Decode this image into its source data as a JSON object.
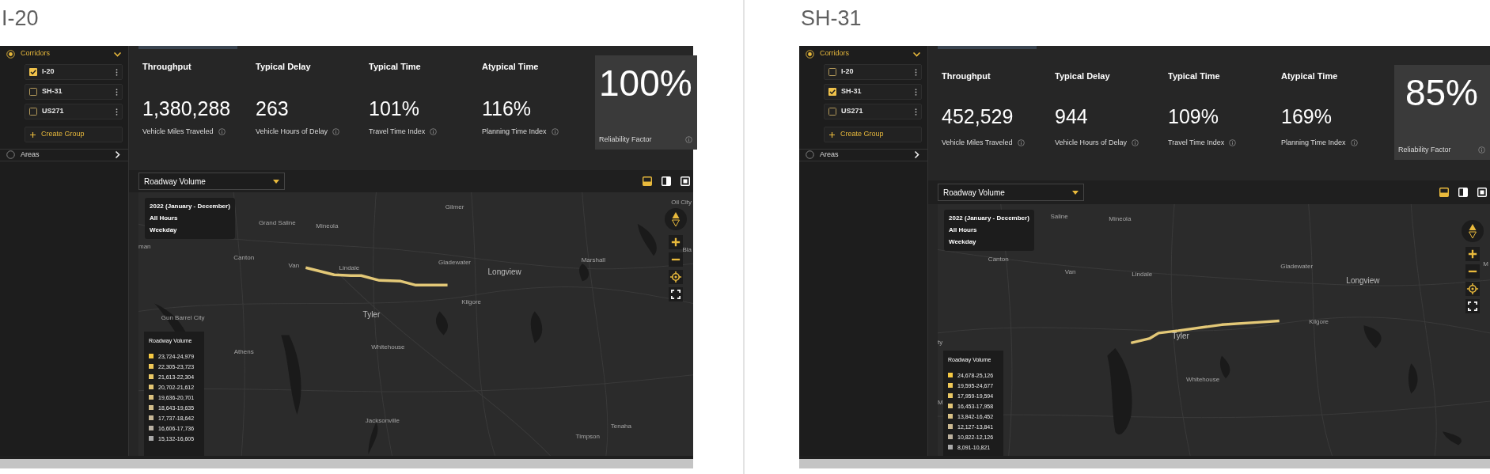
{
  "panels": [
    {
      "heading": "I-20",
      "sidebar": [
        {
          "label": "Corridors",
          "selected": true,
          "expanded": true,
          "items": [
            {
              "label": "I-20",
              "checked": true
            },
            {
              "label": "SH-31",
              "checked": false
            },
            {
              "label": "US271",
              "checked": false
            }
          ],
          "create": "Create Group"
        },
        {
          "label": "Areas",
          "selected": false,
          "expanded": false
        }
      ],
      "metrics": [
        {
          "kind": "plain",
          "title": "Throughput",
          "value": "1,380,288",
          "caption": "Vehicle Miles Traveled"
        },
        {
          "kind": "plain",
          "title": "Typical Delay",
          "value": "263",
          "caption": "Vehicle Hours of Delay"
        },
        {
          "kind": "plain",
          "title": "Typical Time",
          "value": "101%",
          "caption": "Travel Time Index"
        },
        {
          "kind": "plain",
          "title": "Atypical Time",
          "value": "116%",
          "caption": "Planning Time Index"
        },
        {
          "kind": "highlight",
          "value": "100%",
          "caption": "Reliability Factor"
        }
      ],
      "toolbar": {
        "dropdown": "Roadway Volume",
        "views": [
          {
            "kind": "bottom",
            "selected": true
          },
          {
            "kind": "side",
            "selected": false
          },
          {
            "kind": "full",
            "selected": false
          }
        ]
      },
      "map": {
        "info": [
          "2022 (January - December)",
          "All Hours",
          "Weekday"
        ],
        "labels": [
          "Oil City",
          "Gilmer",
          "Grand Saline",
          "Mineola",
          "man",
          "Canton",
          "Van",
          "Lindale",
          "Gladewater",
          "Longview",
          "Marshall",
          "Bla",
          "Kilgore",
          "Tyler",
          "Gun Barrel City",
          "Athens",
          "Whitehouse",
          "Jacksonville",
          "Tenaha",
          "Timpson"
        ],
        "legend": {
          "title": "Roadway Volume",
          "items": [
            {
              "label": "23,724-24,979",
              "color": "#f5c842"
            },
            {
              "label": "22,305-23,723",
              "color": "#f0c857"
            },
            {
              "label": "21,613-22,304",
              "color": "#eac865"
            },
            {
              "label": "20,702-21,612",
              "color": "#e4c673"
            },
            {
              "label": "19,636-20,701",
              "color": "#dcc27f"
            },
            {
              "label": "18,643-19,635",
              "color": "#d2bd8a"
            },
            {
              "label": "17,737-18,642",
              "color": "#c7b796"
            },
            {
              "label": "16,606-17,736",
              "color": "#b8b0a3"
            },
            {
              "label": "15,132-16,605",
              "color": "#a9a9a9"
            }
          ]
        }
      }
    },
    {
      "heading": "SH-31",
      "sidebar": [
        {
          "label": "Corridors",
          "selected": true,
          "expanded": true,
          "items": [
            {
              "label": "I-20",
              "checked": false
            },
            {
              "label": "SH-31",
              "checked": true
            },
            {
              "label": "US271",
              "checked": false
            }
          ],
          "create": "Create Group"
        },
        {
          "label": "Areas",
          "selected": false,
          "expanded": false
        }
      ],
      "metrics": [
        {
          "kind": "plain",
          "title": "Throughput",
          "value": "452,529",
          "caption": "Vehicle Miles Traveled"
        },
        {
          "kind": "plain",
          "title": "Typical Delay",
          "value": "944",
          "caption": "Vehicle Hours of Delay"
        },
        {
          "kind": "plain",
          "title": "Typical Time",
          "value": "109%",
          "caption": "Travel Time Index"
        },
        {
          "kind": "plain",
          "title": "Atypical Time",
          "value": "169%",
          "caption": "Planning Time Index"
        },
        {
          "kind": "highlight",
          "value": "85%",
          "caption": "Reliability Factor"
        }
      ],
      "toolbar": {
        "dropdown": "Roadway Volume",
        "views": [
          {
            "kind": "bottom",
            "selected": true
          },
          {
            "kind": "side",
            "selected": false
          },
          {
            "kind": "full",
            "selected": false
          }
        ]
      },
      "map": {
        "info": [
          "2022 (January - December)",
          "All Hours",
          "Weekday"
        ],
        "labels": [
          "Saline",
          "Mineola",
          "Canton",
          "Van",
          "Lindale",
          "Gladewater",
          "Longview",
          "M",
          "Kilgore",
          "Tyler",
          "ty",
          "Whitehouse",
          "M"
        ],
        "legend": {
          "title": "Roadway Volume",
          "items": [
            {
              "label": "24,678-25,126",
              "color": "#f5c842"
            },
            {
              "label": "19,595-24,677",
              "color": "#f0c857"
            },
            {
              "label": "17,959-19,594",
              "color": "#eac865"
            },
            {
              "label": "16,453-17,958",
              "color": "#e2c577"
            },
            {
              "label": "13,842-16,452",
              "color": "#d8c085"
            },
            {
              "label": "12,127-13,841",
              "color": "#ccba92"
            },
            {
              "label": "10,822-12,126",
              "color": "#bdb29f"
            },
            {
              "label": "8,091-10,821",
              "color": "#aaaaaa"
            }
          ]
        }
      }
    }
  ]
}
